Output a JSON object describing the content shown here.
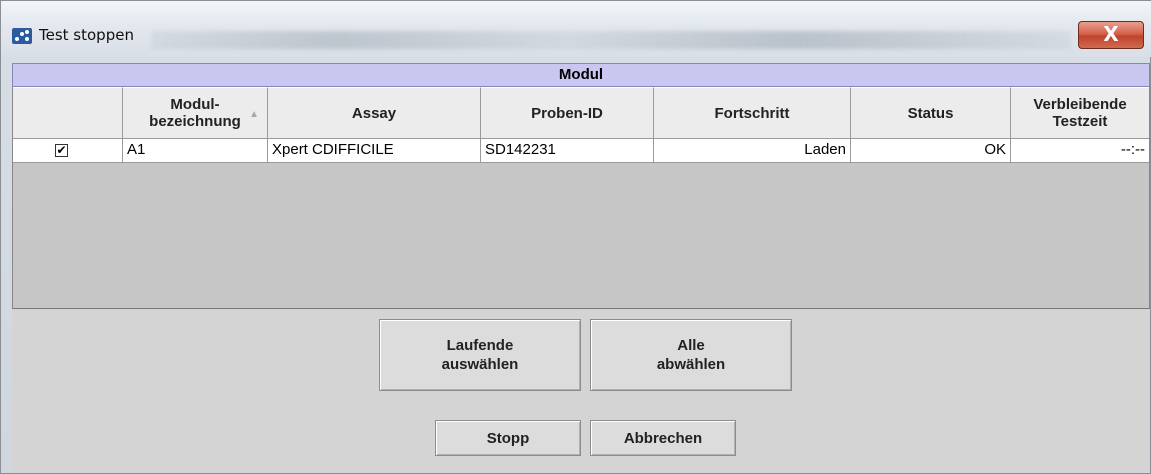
{
  "window": {
    "title": "Test stoppen",
    "close_glyph": "X"
  },
  "module": {
    "header": "Modul"
  },
  "table": {
    "columns": [
      {
        "line1": "",
        "line2": ""
      },
      {
        "line1": "Modul-",
        "line2": "bezeichnung"
      },
      {
        "line1": "Assay",
        "line2": ""
      },
      {
        "line1": "Proben-ID",
        "line2": ""
      },
      {
        "line1": "Fortschritt",
        "line2": ""
      },
      {
        "line1": "Status",
        "line2": ""
      },
      {
        "line1": "Verbleibende",
        "line2": "Testzeit"
      }
    ],
    "sort_indicator": "▲",
    "rows": [
      {
        "checked": true,
        "check_glyph": "✔",
        "modul": "A1",
        "assay": "Xpert CDIFFICILE",
        "proben_id": "SD142231",
        "fortschritt": "Laden",
        "status": "OK",
        "testzeit": "--:--"
      }
    ]
  },
  "buttons": {
    "select_running": {
      "line1": "Laufende",
      "line2": "auswählen"
    },
    "deselect_all": {
      "line1": "Alle",
      "line2": "abwählen"
    },
    "stop": "Stopp",
    "cancel": "Abbrechen"
  },
  "colors": {
    "module_header_bg": "#c9c7f0",
    "close_button": "#c0432b",
    "app_icon": "#2b5a9e"
  },
  "icons": {
    "app": "cepheid-dots-icon",
    "close": "close-icon",
    "checkbox": "checkmark-icon",
    "sort": "sort-ascending-icon"
  }
}
